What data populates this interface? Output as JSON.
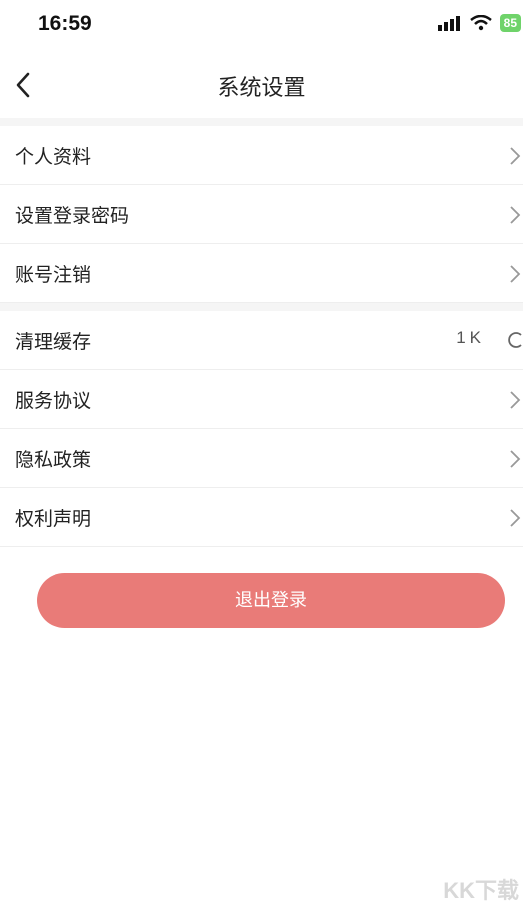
{
  "status_bar": {
    "time": "16:59",
    "battery": "85"
  },
  "nav": {
    "title": "系统设置"
  },
  "group1": [
    {
      "label": "个人资料"
    },
    {
      "label": "设置登录密码"
    },
    {
      "label": "账号注销"
    }
  ],
  "group2": {
    "cache": {
      "label": "清理缓存",
      "value": "1K"
    },
    "items": [
      {
        "label": "服务协议"
      },
      {
        "label": "隐私政策"
      },
      {
        "label": "权利声明"
      }
    ]
  },
  "logout": {
    "label": "退出登录"
  },
  "colors": {
    "accent": "#e97b78",
    "battery": "#6fd36a"
  },
  "watermark": "KK下载"
}
